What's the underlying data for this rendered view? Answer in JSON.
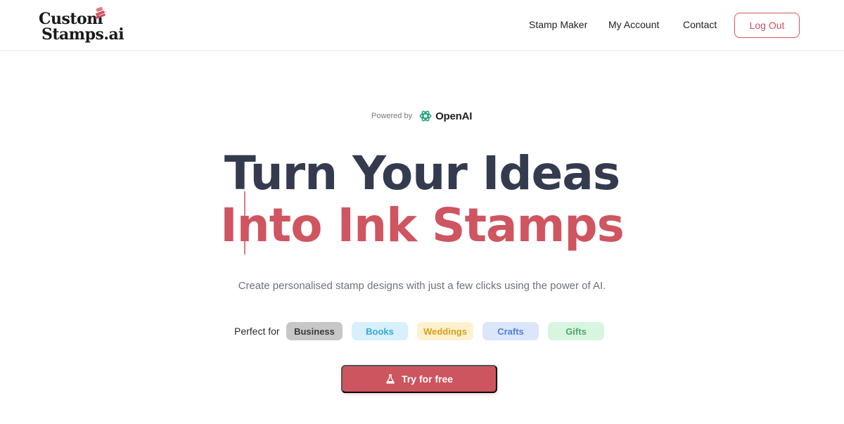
{
  "header": {
    "logo": {
      "line1": "Custom",
      "line2": "Stamps.ai"
    },
    "nav": [
      {
        "label": "Stamp Maker"
      },
      {
        "label": "My Account"
      },
      {
        "label": "Contact"
      }
    ],
    "logout_label": "Log Out"
  },
  "hero": {
    "powered_label": "Powered by",
    "powered_brand": "OpenAI",
    "headline_line1": "Turn Your Ideas",
    "headline_line2": "Into Ink Stamps",
    "subtext": "Create personalised stamp designs with just a few clicks using the power of AI.",
    "perfect_for_label": "Perfect for",
    "tags": [
      {
        "label": "Business",
        "bg": "#c7c7c7",
        "fg": "#3a3a3a"
      },
      {
        "label": "Books",
        "bg": "#d7f0fb",
        "fg": "#35a9d6"
      },
      {
        "label": "Weddings",
        "bg": "#fdf1cf",
        "fg": "#d69e1e"
      },
      {
        "label": "Crafts",
        "bg": "#dbe6fb",
        "fg": "#4f80d8"
      },
      {
        "label": "Gifts",
        "bg": "#d8f5e0",
        "fg": "#4ea76b"
      }
    ],
    "cta_label": "Try for free"
  },
  "colors": {
    "accent": "#cd5560",
    "headline_dark": "#343b4f"
  },
  "icons": {
    "logo_stamp": "stamp-icon",
    "powered_brand": "openai-icon",
    "cta": "flask-icon"
  }
}
